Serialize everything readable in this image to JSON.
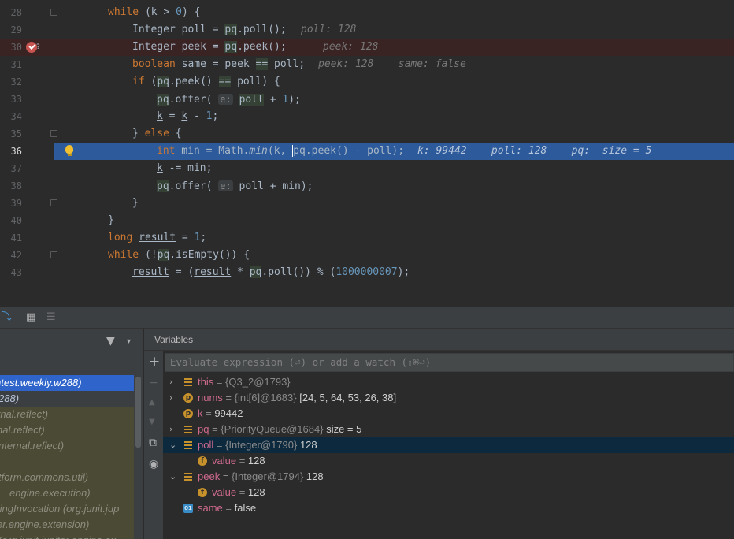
{
  "editor": {
    "lines": [
      {
        "num": "28",
        "segments": [
          {
            "t": "while",
            "c": "kw"
          },
          {
            "t": " (k > "
          },
          {
            "t": "0",
            "c": "num"
          },
          {
            "t": ") {"
          }
        ]
      },
      {
        "num": "29",
        "segments": [
          {
            "t": "Integer poll = "
          },
          {
            "t": "pq",
            "c": "hl"
          },
          {
            "t": ".poll();"
          }
        ],
        "debug": "poll: 128"
      },
      {
        "num": "30",
        "segments": [
          {
            "t": "Integer peek = "
          },
          {
            "t": "pq",
            "c": "hl"
          },
          {
            "t": ".peek();"
          }
        ],
        "debug": "peek: 128"
      },
      {
        "num": "31",
        "segments": [
          {
            "t": "boolean",
            "c": "kw"
          },
          {
            "t": " same = peek "
          },
          {
            "t": "==",
            "c": "hl"
          },
          {
            "t": " poll;"
          }
        ],
        "debug": "peek: 128    same: false"
      },
      {
        "num": "32",
        "segments": [
          {
            "t": "if",
            "c": "kw"
          },
          {
            "t": " ("
          },
          {
            "t": "pq",
            "c": "hl"
          },
          {
            "t": ".peek() "
          },
          {
            "t": "==",
            "c": "hl"
          },
          {
            "t": " poll) {"
          }
        ]
      },
      {
        "num": "33",
        "segments": [
          {
            "t": "pq",
            "c": "hl"
          },
          {
            "t": ".offer( "
          },
          {
            "t": "e:",
            "c": "hint"
          },
          {
            "t": " "
          },
          {
            "t": "poll",
            "c": "hl"
          },
          {
            "t": " + "
          },
          {
            "t": "1",
            "c": "num"
          },
          {
            "t": ");"
          }
        ]
      },
      {
        "num": "34",
        "segments": [
          {
            "t": "k",
            "c": "ul"
          },
          {
            "t": " = "
          },
          {
            "t": "k",
            "c": "ul"
          },
          {
            "t": " - "
          },
          {
            "t": "1",
            "c": "num"
          },
          {
            "t": ";"
          }
        ]
      },
      {
        "num": "35",
        "segments": [
          {
            "t": "} "
          },
          {
            "t": "else",
            "c": "kw"
          },
          {
            "t": " {"
          }
        ]
      },
      {
        "num": "36",
        "segments": [
          {
            "t": "int",
            "c": "kw"
          },
          {
            "t": " min = Math."
          },
          {
            "t": "min",
            "c": "it"
          },
          {
            "t": "(k, "
          },
          {
            "t": "|",
            "c": "caret"
          },
          {
            "t": "pq.peek() - poll);"
          }
        ],
        "debug": "k: 99442    poll: 128    pq:  size = 5"
      },
      {
        "num": "37",
        "segments": [
          {
            "t": "k",
            "c": "ul"
          },
          {
            "t": " -= min;"
          }
        ]
      },
      {
        "num": "38",
        "segments": [
          {
            "t": "pq",
            "c": "hl"
          },
          {
            "t": ".offer( "
          },
          {
            "t": "e:",
            "c": "hint"
          },
          {
            "t": " poll + min);"
          }
        ]
      },
      {
        "num": "39",
        "segments": [
          {
            "t": "}"
          }
        ]
      },
      {
        "num": "40",
        "segments": [
          {
            "t": "}"
          }
        ]
      },
      {
        "num": "41",
        "segments": [
          {
            "t": "long",
            "c": "kw"
          },
          {
            "t": " "
          },
          {
            "t": "result",
            "c": "ul"
          },
          {
            "t": " = "
          },
          {
            "t": "1",
            "c": "num"
          },
          {
            "t": ";"
          }
        ]
      },
      {
        "num": "42",
        "segments": [
          {
            "t": "while",
            "c": "kw"
          },
          {
            "t": " (!"
          },
          {
            "t": "pq",
            "c": "hl"
          },
          {
            "t": ".isEmpty()) {"
          }
        ]
      },
      {
        "num": "43",
        "segments": [
          {
            "t": "result",
            "c": "ul"
          },
          {
            "t": " = ("
          },
          {
            "t": "result",
            "c": "ul"
          },
          {
            "t": " * "
          },
          {
            "t": "pq",
            "c": "hl"
          },
          {
            "t": ".poll()) % ("
          },
          {
            "t": "1000000007",
            "c": "num"
          },
          {
            "t": ");"
          }
        ]
      }
    ]
  },
  "frames": {
    "items": [
      {
        "text": "ntest.weekly.w288)",
        "kind": "sel"
      },
      {
        "text": "288)",
        "kind": "sel2"
      },
      {
        "text": "rnal.reflect)",
        "kind": "lib"
      },
      {
        "text": "nal.reflect)",
        "kind": "lib"
      },
      {
        "text": "nternal.reflect)",
        "kind": "lib"
      },
      {
        "text": "",
        "kind": "lib"
      },
      {
        "text": "tform.commons.util)",
        "kind": "lib"
      },
      {
        "text": "engine.execution)",
        "kind": "lib"
      },
      {
        "text": "tingInvocation (org.junit.jup",
        "kind": "lib"
      },
      {
        "text": "er.engine.extension)",
        "kind": "lib"
      },
      {
        "text": "(org.junit.jupiter.engine.ex",
        "kind": "lib"
      }
    ]
  },
  "variables": {
    "title": "Variables",
    "eval_placeholder": "Evaluate expression (⏎) or add a watch (⇧⌘⏎)",
    "rows": [
      {
        "name": "this",
        "type": " = {Q3_2@1793}",
        "value": "",
        "icon": "obj",
        "arrow": "›",
        "indent": 0
      },
      {
        "name": "nums",
        "type": " = {int[6]@1683}",
        "value": " [24, 5, 64, 53, 26, 38]",
        "icon": "p",
        "arrow": "›",
        "indent": 0
      },
      {
        "name": "k",
        "type": " = ",
        "value": "99442",
        "icon": "p",
        "arrow": "",
        "indent": 0
      },
      {
        "name": "pq",
        "type": " = {PriorityQueue@1684}",
        "value": "  size = 5",
        "icon": "obj",
        "arrow": "›",
        "indent": 0
      },
      {
        "name": "poll",
        "type": " = {Integer@1790}",
        "value": " 128",
        "icon": "obj",
        "arrow": "⌄",
        "indent": 0,
        "selected": true
      },
      {
        "name": "value",
        "type": " = ",
        "value": "128",
        "icon": "f",
        "arrow": "",
        "indent": 1
      },
      {
        "name": "peek",
        "type": " = {Integer@1794}",
        "value": " 128",
        "icon": "obj",
        "arrow": "⌄",
        "indent": 0
      },
      {
        "name": "value",
        "type": " = ",
        "value": "128",
        "icon": "f",
        "arrow": "",
        "indent": 1
      },
      {
        "name": "same",
        "type": " = ",
        "value": "false",
        "icon": "bool",
        "arrow": "",
        "indent": 0
      }
    ]
  },
  "icons": {
    "toolbar": [
      "step-icon",
      "table-icon",
      "list-icon"
    ],
    "sidebar": [
      "add-icon",
      "remove-icon",
      "up-icon",
      "down-icon",
      "copy-icon",
      "watch-eye-icon"
    ]
  }
}
